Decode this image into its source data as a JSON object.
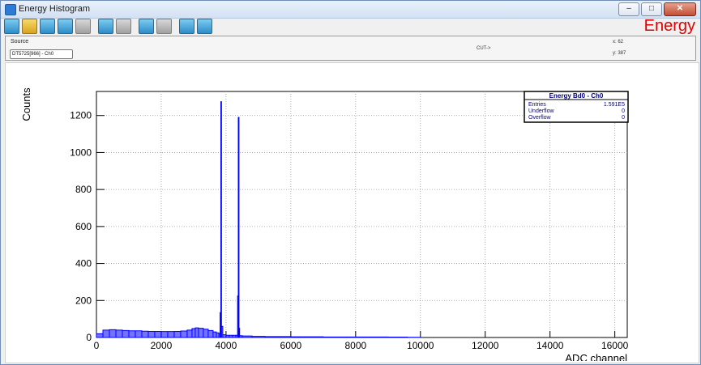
{
  "window": {
    "title": "Energy Histogram",
    "minimize": "‒",
    "maximize": "□",
    "close": "✕"
  },
  "toolbar": {
    "icons": [
      "reset-icon",
      "open-folder-icon",
      "zoom-icon",
      "list-icon",
      "peak-icon",
      "save-icon",
      "save-disabled-icon",
      "cut-icon",
      "cut-disabled-icon",
      "snapshot-icon",
      "export-icon"
    ]
  },
  "header": {
    "energy_label": "Energy"
  },
  "source": {
    "label": "Source",
    "value": "DT5725[966] - Ch0",
    "cut_label": "CUT->",
    "x_text": "x:  62",
    "y_text": "y:  387"
  },
  "stats": {
    "title": "Energy Bd0 - Ch0",
    "rows": [
      {
        "label": "Entries",
        "value": "1.591E5"
      },
      {
        "label": "Underflow",
        "value": "0"
      },
      {
        "label": "Overflow",
        "value": "0"
      }
    ]
  },
  "chart_data": {
    "type": "histogram",
    "xlabel": "ADC channel",
    "ylabel": "Counts",
    "xlim": [
      0,
      16384
    ],
    "ylim": [
      0,
      1330
    ],
    "x_ticks": [
      0,
      2000,
      4000,
      6000,
      8000,
      10000,
      12000,
      14000,
      16000
    ],
    "y_ticks": [
      0,
      200,
      400,
      600,
      800,
      1000,
      1200
    ],
    "grid": true,
    "color": "#0000ff",
    "series": [
      {
        "x": [
          0,
          200,
          400,
          600,
          800,
          1000,
          1200,
          1400,
          1600,
          1800,
          2000,
          2200,
          2400,
          2600,
          2800,
          2950,
          3050,
          3150,
          3300,
          3450,
          3600,
          3700,
          3780,
          3820,
          3840,
          3860,
          3900,
          4000,
          4100,
          4200,
          4300,
          4360,
          4380,
          4400,
          4420,
          4500,
          4800,
          5200,
          6000,
          7000,
          8000,
          9000,
          9600,
          10000
        ],
        "y": [
          20,
          40,
          42,
          40,
          38,
          36,
          36,
          34,
          33,
          33,
          32,
          32,
          33,
          35,
          40,
          48,
          52,
          50,
          45,
          38,
          30,
          25,
          20,
          135,
          1275,
          60,
          15,
          12,
          12,
          12,
          12,
          225,
          1190,
          50,
          10,
          8,
          6,
          5,
          4,
          3,
          3,
          2,
          1,
          0
        ]
      }
    ]
  }
}
